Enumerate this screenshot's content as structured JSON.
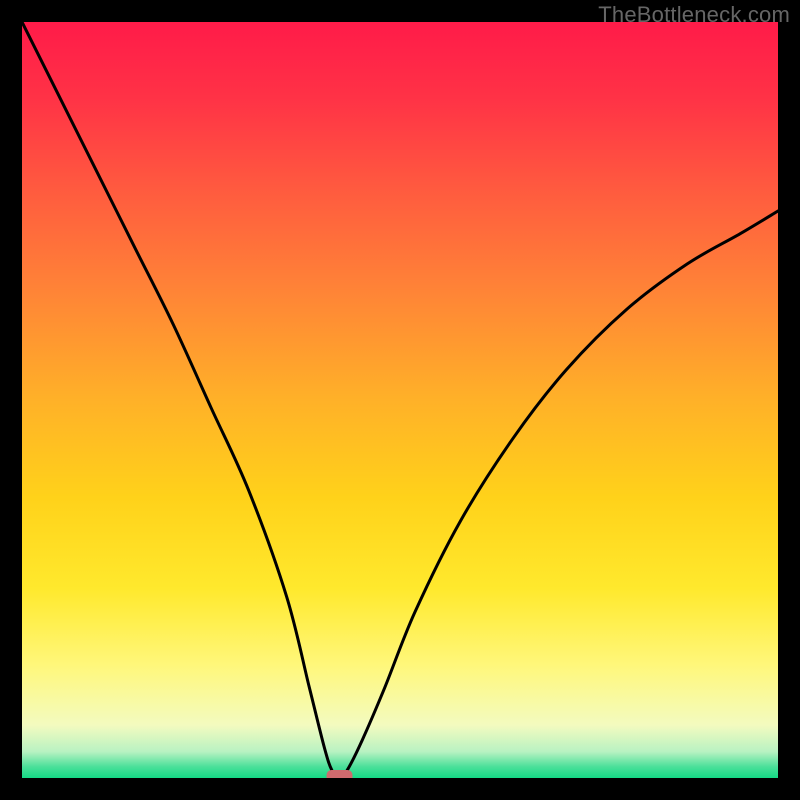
{
  "watermark": "TheBottleneck.com",
  "chart_data": {
    "type": "line",
    "title": "",
    "xlabel": "",
    "ylabel": "",
    "xlim": [
      0,
      100
    ],
    "ylim": [
      0,
      100
    ],
    "series": [
      {
        "name": "bottleneck-curve",
        "x": [
          0,
          5,
          10,
          15,
          20,
          25,
          30,
          35,
          38,
          40,
          41,
          42,
          43,
          45,
          48,
          52,
          58,
          65,
          72,
          80,
          88,
          95,
          100
        ],
        "y": [
          100,
          90,
          80,
          70,
          60,
          49,
          38,
          24,
          12,
          4,
          1,
          0,
          1,
          5,
          12,
          22,
          34,
          45,
          54,
          62,
          68,
          72,
          75
        ]
      }
    ],
    "marker": {
      "x": 42,
      "y": 0,
      "color": "#cf6a6e"
    },
    "gradient_stops": [
      {
        "pos": 0.0,
        "color": "#ff1b49"
      },
      {
        "pos": 0.1,
        "color": "#ff3246"
      },
      {
        "pos": 0.22,
        "color": "#ff5a3f"
      },
      {
        "pos": 0.35,
        "color": "#ff8237"
      },
      {
        "pos": 0.5,
        "color": "#ffb128"
      },
      {
        "pos": 0.63,
        "color": "#ffd21a"
      },
      {
        "pos": 0.75,
        "color": "#ffe92d"
      },
      {
        "pos": 0.85,
        "color": "#fff77a"
      },
      {
        "pos": 0.93,
        "color": "#f3fbbf"
      },
      {
        "pos": 0.965,
        "color": "#b9f2c2"
      },
      {
        "pos": 0.985,
        "color": "#4be09a"
      },
      {
        "pos": 1.0,
        "color": "#15d985"
      }
    ]
  }
}
